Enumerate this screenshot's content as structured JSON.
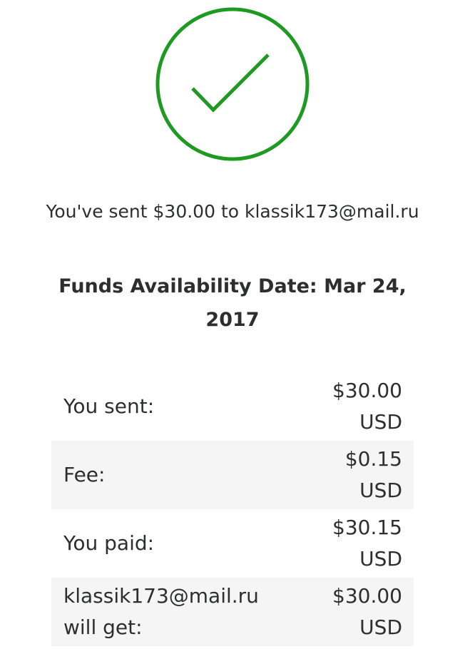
{
  "status": {
    "icon": "checkmark-circle-icon",
    "color": "#1e9a22"
  },
  "message": {
    "sent_text": "You've sent $30.00 to klassik173@mail.ru"
  },
  "availability": {
    "text": "Funds Availability Date: Mar 24, 2017"
  },
  "summary": {
    "rows": [
      {
        "label": "You sent:",
        "amount": "$30.00",
        "currency": "USD"
      },
      {
        "label": "Fee:",
        "amount": "$0.15",
        "currency": "USD"
      },
      {
        "label": "You paid:",
        "amount": "$30.15",
        "currency": "USD"
      },
      {
        "label_line1": "klassik173@mail.ru",
        "label_line2": "will get:",
        "amount": "$30.00",
        "currency": "USD"
      }
    ]
  }
}
